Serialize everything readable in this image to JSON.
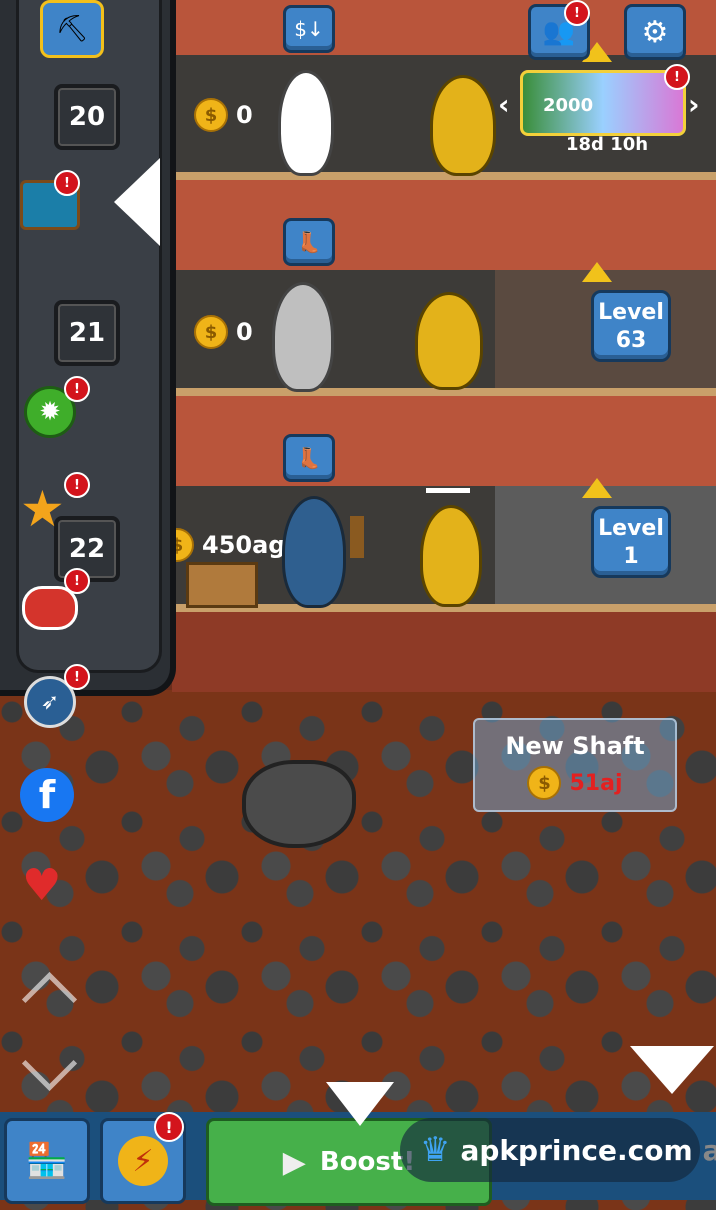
{
  "sidebar": {
    "levels": [
      "20",
      "21",
      "22"
    ],
    "notice": "!"
  },
  "shafts": [
    {
      "money": "0",
      "level": ""
    },
    {
      "money": "0",
      "level_label": "Level",
      "level_num": "63"
    },
    {
      "money": "450ag",
      "level_label": "Level",
      "level_num": "1"
    }
  ],
  "event": {
    "value": "2000",
    "timer": "18d 10h"
  },
  "new_shaft": {
    "title": "New Shaft",
    "cost": "51aj"
  },
  "bottom": {
    "boost": "Boost!"
  },
  "watermark": {
    "site": "apkprince.com",
    "tag": "an"
  },
  "colors": {
    "dirt": "#b9553b",
    "sign": "#3f84c8",
    "coin": "#f0b418",
    "badge": "#d3141c",
    "boost": "#46b04a"
  },
  "icons": [
    "pickaxe-icon",
    "treasure-chest-icon",
    "gear-badge-icon",
    "star-icon",
    "sushi-icon",
    "compass-icon",
    "facebook-icon",
    "heart-thumb-icon",
    "shop-icon",
    "lightning-icon",
    "settings-icon",
    "friends-icon",
    "sort-icon",
    "boot-icon"
  ]
}
